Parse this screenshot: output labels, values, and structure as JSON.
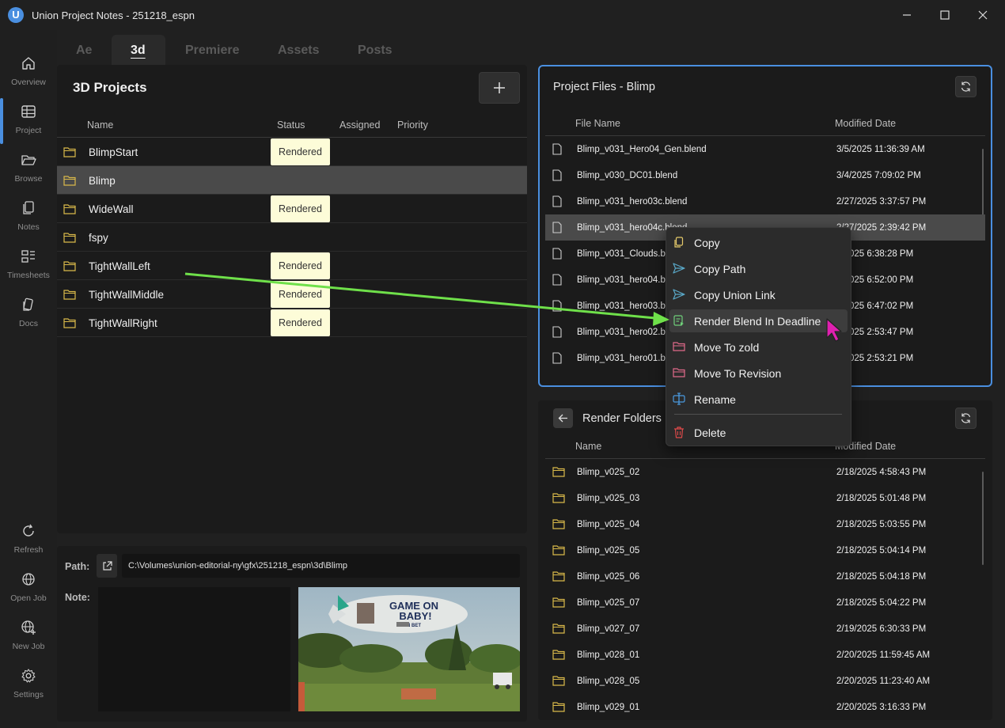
{
  "window": {
    "title": "Union Project Notes - 251218_espn",
    "logo": "U"
  },
  "nav": [
    {
      "label": "Overview",
      "icon": "home-icon"
    },
    {
      "label": "Project",
      "icon": "table-icon"
    },
    {
      "label": "Browse",
      "icon": "folder-open-icon"
    },
    {
      "label": "Notes",
      "icon": "notes-icon"
    },
    {
      "label": "Timesheets",
      "icon": "timesheet-icon"
    },
    {
      "label": "Docs",
      "icon": "docs-icon"
    },
    {
      "label": "Refresh",
      "icon": "refresh-icon"
    },
    {
      "label": "Open Job",
      "icon": "globe-icon"
    },
    {
      "label": "New Job",
      "icon": "globe-plus-icon"
    },
    {
      "label": "Settings",
      "icon": "gear-icon"
    }
  ],
  "tabs": [
    "Ae",
    "3d",
    "Premiere",
    "Assets",
    "Posts"
  ],
  "active_tab": "3d",
  "projects": {
    "title": "3D Projects",
    "add_label": "+",
    "columns": [
      "Name",
      "Status",
      "Assigned",
      "Priority"
    ],
    "rows": [
      {
        "name": "BlimpStart",
        "status": "Rendered"
      },
      {
        "name": "Blimp",
        "status": ""
      },
      {
        "name": "WideWall",
        "status": "Rendered"
      },
      {
        "name": "fspy",
        "status": ""
      },
      {
        "name": "TightWallLeft",
        "status": "Rendered"
      },
      {
        "name": "TightWallMiddle",
        "status": "Rendered"
      },
      {
        "name": "TightWallRight",
        "status": "Rendered"
      }
    ],
    "selected": "Blimp"
  },
  "details": {
    "path_label": "Path:",
    "path_value": "C:\\Volumes\\union-editorial-ny\\gfx\\251218_espn\\3d\\Blimp",
    "note_label": "Note:",
    "thumbnail": {
      "blimp_text_line1": "GAME ON",
      "blimp_text_line2": "BABY!",
      "blimp_brand": "ESPN BET"
    }
  },
  "project_files": {
    "title": "Project Files - Blimp",
    "columns": [
      "File Name",
      "Modified Date"
    ],
    "rows": [
      {
        "name": "Blimp_v031_Hero04_Gen.blend",
        "date": "3/5/2025 11:36:39 AM"
      },
      {
        "name": "Blimp_v030_DC01.blend",
        "date": "3/4/2025 7:09:02 PM"
      },
      {
        "name": "Blimp_v031_hero03c.blend",
        "date": "2/27/2025 3:37:57 PM"
      },
      {
        "name": "Blimp_v031_hero04c.blend",
        "date": "2/27/2025 2:39:42 PM"
      },
      {
        "name": "Blimp_v031_Clouds.blend",
        "date": "2/26/2025 6:38:28 PM"
      },
      {
        "name": "Blimp_v031_hero04.blend",
        "date": "2/25/2025 6:52:00 PM"
      },
      {
        "name": "Blimp_v031_hero03.blend",
        "date": "2/25/2025 6:47:02 PM"
      },
      {
        "name": "Blimp_v031_hero02.blend",
        "date": "2/25/2025 2:53:47 PM"
      },
      {
        "name": "Blimp_v031_hero01.blend",
        "date": "2/25/2025 2:53:21 PM"
      }
    ],
    "visible_names": [
      "Blimp_v031_Hero04_Gen.blend",
      "Blimp_v030_DC01.blend",
      "Blimp_v031_hero03c.blend",
      "Blimp_v031_hero04c.blend",
      "Blimp_v031_Clouds.bl",
      "Blimp_v031_hero04.bl",
      "Blimp_v031_hero03.bl",
      "Blimp_v031_hero02.bl",
      "Blimp_v031_hero01.bl"
    ],
    "visible_dates": [
      "3/5/2025 11:36:39 AM",
      "3/4/2025 7:09:02 PM",
      "2/27/2025 3:37:57 PM",
      "2/27/2025 2:39:42 PM",
      "6/2025 6:38:28 PM",
      "5/2025 6:52:00 PM",
      "5/2025 6:47:02 PM",
      "5/2025 2:53:47 PM",
      "5/2025 2:53:21 PM"
    ],
    "selected_index": 3
  },
  "render_folders": {
    "title": "Render Folders",
    "columns": [
      "Name",
      "Modified Date"
    ],
    "rows": [
      {
        "name": "Blimp_v025_02",
        "date": "2/18/2025 4:58:43 PM"
      },
      {
        "name": "Blimp_v025_03",
        "date": "2/18/2025 5:01:48 PM"
      },
      {
        "name": "Blimp_v025_04",
        "date": "2/18/2025 5:03:55 PM"
      },
      {
        "name": "Blimp_v025_05",
        "date": "2/18/2025 5:04:14 PM"
      },
      {
        "name": "Blimp_v025_06",
        "date": "2/18/2025 5:04:18 PM"
      },
      {
        "name": "Blimp_v025_07",
        "date": "2/18/2025 5:04:22 PM"
      },
      {
        "name": "Blimp_v027_07",
        "date": "2/19/2025 6:30:33 PM"
      },
      {
        "name": "Blimp_v028_01",
        "date": "2/20/2025 11:59:45 AM"
      },
      {
        "name": "Blimp_v028_05",
        "date": "2/20/2025 11:23:40 AM"
      },
      {
        "name": "Blimp_v029_01",
        "date": "2/20/2025 3:16:33 PM"
      }
    ]
  },
  "context_menu": {
    "items": [
      {
        "label": "Copy",
        "icon": "copy-icon"
      },
      {
        "label": "Copy Path",
        "icon": "send-icon"
      },
      {
        "label": "Copy Union Link",
        "icon": "send-icon"
      },
      {
        "label": "Render Blend In Deadline",
        "icon": "render-icon"
      },
      {
        "label": "Move To zold",
        "icon": "folder-icon"
      },
      {
        "label": "Move To Revision",
        "icon": "folder-icon"
      },
      {
        "label": "Rename",
        "icon": "rename-icon"
      },
      {
        "label": "Delete",
        "icon": "trash-icon"
      }
    ],
    "hover_index": 3
  },
  "colors": {
    "accent": "#4a8fe0",
    "badge_bg": "#fdfcd8",
    "annotation_arrow": "#6fe04a",
    "cursor": "#e020b0",
    "folder": "#d9b94a"
  }
}
